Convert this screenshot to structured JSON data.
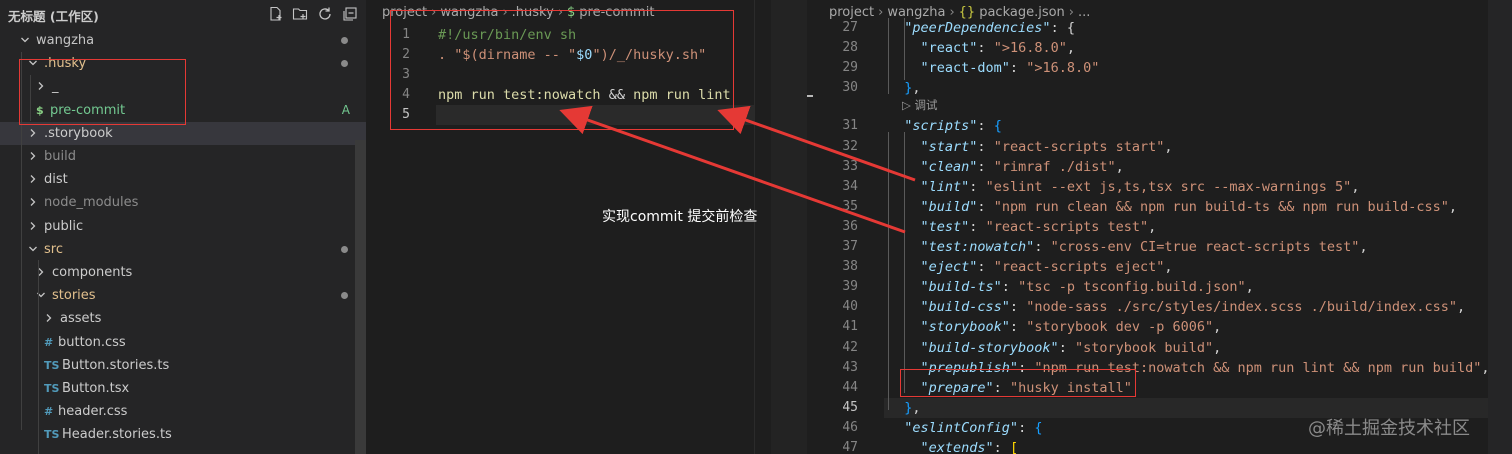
{
  "explorer": {
    "title": "无标题 (工作区)",
    "actions": [
      "new-file-icon",
      "new-folder-icon",
      "refresh-icon",
      "collapse-all-icon"
    ],
    "rows": [
      {
        "label": "wangzha",
        "type": "folder",
        "open": true,
        "depth": 1,
        "color": "#c5c5c5",
        "dot": true
      },
      {
        "label": ".husky",
        "type": "folder",
        "open": true,
        "depth": 2,
        "color": "#e2c08d",
        "dot": true
      },
      {
        "label": "_",
        "type": "folder",
        "open": false,
        "depth": 3,
        "color": "#cccccc"
      },
      {
        "label": "pre-commit",
        "type": "file",
        "icon": "$",
        "iconColor": "#89d185",
        "depth": 3,
        "color": "#73c991",
        "badge": "A"
      },
      {
        "label": ".storybook",
        "type": "folder",
        "open": false,
        "depth": 2,
        "color": "#cccccc",
        "selected": true
      },
      {
        "label": "build",
        "type": "folder",
        "open": false,
        "depth": 2,
        "color": "#8c8c8c"
      },
      {
        "label": "dist",
        "type": "folder",
        "open": false,
        "depth": 2,
        "color": "#cccccc"
      },
      {
        "label": "node_modules",
        "type": "folder",
        "open": false,
        "depth": 2,
        "color": "#8c8c8c"
      },
      {
        "label": "public",
        "type": "folder",
        "open": false,
        "depth": 2,
        "color": "#cccccc"
      },
      {
        "label": "src",
        "type": "folder",
        "open": true,
        "depth": 2,
        "color": "#e2c08d",
        "dot": true
      },
      {
        "label": "components",
        "type": "folder",
        "open": false,
        "depth": 3,
        "color": "#cccccc"
      },
      {
        "label": "stories",
        "type": "folder",
        "open": true,
        "depth": 3,
        "color": "#e2c08d",
        "dot": true
      },
      {
        "label": "assets",
        "type": "folder",
        "open": false,
        "depth": 4,
        "color": "#cccccc"
      },
      {
        "label": "button.css",
        "type": "file",
        "icon": "#",
        "iconColor": "#519aba",
        "depth": 4,
        "color": "#cccccc"
      },
      {
        "label": "Button.stories.ts",
        "type": "file",
        "icon": "TS",
        "iconColor": "#519aba",
        "depth": 4,
        "color": "#cccccc"
      },
      {
        "label": "Button.tsx",
        "type": "file",
        "icon": "TS",
        "iconColor": "#519aba",
        "depth": 4,
        "color": "#cccccc"
      },
      {
        "label": "header.css",
        "type": "file",
        "icon": "#",
        "iconColor": "#519aba",
        "depth": 4,
        "color": "#cccccc"
      },
      {
        "label": "Header.stories.ts",
        "type": "file",
        "icon": "TS",
        "iconColor": "#519aba",
        "depth": 4,
        "color": "#cccccc"
      }
    ]
  },
  "editor1": {
    "breadcrumb": [
      "project",
      "wangzha",
      ".husky",
      "$",
      "pre-commit"
    ],
    "lines": [
      {
        "n": "1",
        "tokens": [
          {
            "t": "#!/usr/bin/env sh",
            "c": "c-comment"
          }
        ]
      },
      {
        "n": "2",
        "tokens": [
          {
            "t": ". \"$(dirname -- \"",
            "c": "c-str"
          },
          {
            "t": "$0",
            "c": "c-var"
          },
          {
            "t": "\")/_/husky.sh\"",
            "c": "c-str"
          }
        ]
      },
      {
        "n": "3",
        "tokens": []
      },
      {
        "n": "4",
        "tokens": [
          {
            "t": "npm run test:nowatch",
            "c": "c-yellow"
          },
          {
            "t": " && ",
            "c": "c-plain"
          },
          {
            "t": "npm run lint",
            "c": "c-yellow"
          }
        ]
      },
      {
        "n": "5",
        "tokens": [],
        "active": true
      }
    ]
  },
  "editor2": {
    "breadcrumb": [
      "project",
      "wangzha",
      "{}",
      "package.json",
      "..."
    ],
    "codelens": "调试",
    "lines": [
      {
        "n": "27",
        "tokens": [
          {
            "t": "  ",
            "c": "c-plain"
          },
          {
            "t": "\"peerDependencies\"",
            "c": "c-key"
          },
          {
            "t": ": {",
            "c": "c-plain"
          }
        ]
      },
      {
        "n": "28",
        "tokens": [
          {
            "t": "    ",
            "c": "c-plain"
          },
          {
            "t": "\"react\"",
            "c": "c-var"
          },
          {
            "t": ": ",
            "c": "c-plain"
          },
          {
            "t": "\">16.8.0\"",
            "c": "c-str"
          },
          {
            "t": ",",
            "c": "c-plain"
          }
        ]
      },
      {
        "n": "29",
        "tokens": [
          {
            "t": "    ",
            "c": "c-plain"
          },
          {
            "t": "\"react-dom\"",
            "c": "c-var"
          },
          {
            "t": ": ",
            "c": "c-plain"
          },
          {
            "t": "\">16.8.0\"",
            "c": "c-str"
          }
        ]
      },
      {
        "n": "30",
        "tokens": [
          {
            "t": "  ",
            "c": "c-plain"
          },
          {
            "t": "}",
            "c": "c-brace2"
          },
          {
            "t": ",",
            "c": "c-plain"
          }
        ]
      },
      {
        "n": "31",
        "tokens": [
          {
            "t": "  ",
            "c": "c-plain"
          },
          {
            "t": "\"scripts\"",
            "c": "c-key"
          },
          {
            "t": ": ",
            "c": "c-plain"
          },
          {
            "t": "{",
            "c": "c-brace2"
          }
        ]
      },
      {
        "n": "32",
        "tokens": [
          {
            "t": "    ",
            "c": "c-plain"
          },
          {
            "t": "\"start\"",
            "c": "c-key"
          },
          {
            "t": ": ",
            "c": "c-plain"
          },
          {
            "t": "\"react-scripts start\"",
            "c": "c-str"
          },
          {
            "t": ",",
            "c": "c-plain"
          }
        ]
      },
      {
        "n": "33",
        "tokens": [
          {
            "t": "    ",
            "c": "c-plain"
          },
          {
            "t": "\"clean\"",
            "c": "c-key"
          },
          {
            "t": ": ",
            "c": "c-plain"
          },
          {
            "t": "\"rimraf ./dist\"",
            "c": "c-str"
          },
          {
            "t": ",",
            "c": "c-plain"
          }
        ]
      },
      {
        "n": "34",
        "tokens": [
          {
            "t": "    ",
            "c": "c-plain"
          },
          {
            "t": "\"lint\"",
            "c": "c-key"
          },
          {
            "t": ": ",
            "c": "c-plain"
          },
          {
            "t": "\"eslint --ext js,ts,tsx src --max-warnings 5\"",
            "c": "c-str"
          },
          {
            "t": ",",
            "c": "c-plain"
          }
        ]
      },
      {
        "n": "35",
        "tokens": [
          {
            "t": "    ",
            "c": "c-plain"
          },
          {
            "t": "\"build\"",
            "c": "c-key"
          },
          {
            "t": ": ",
            "c": "c-plain"
          },
          {
            "t": "\"npm run clean && npm run build-ts && npm run build-css\"",
            "c": "c-str"
          },
          {
            "t": ",",
            "c": "c-plain"
          }
        ]
      },
      {
        "n": "36",
        "tokens": [
          {
            "t": "    ",
            "c": "c-plain"
          },
          {
            "t": "\"test\"",
            "c": "c-key"
          },
          {
            "t": ": ",
            "c": "c-plain"
          },
          {
            "t": "\"react-scripts test\"",
            "c": "c-str"
          },
          {
            "t": ",",
            "c": "c-plain"
          }
        ]
      },
      {
        "n": "37",
        "tokens": [
          {
            "t": "    ",
            "c": "c-plain"
          },
          {
            "t": "\"test:nowatch\"",
            "c": "c-key"
          },
          {
            "t": ": ",
            "c": "c-plain"
          },
          {
            "t": "\"cross-env CI=true react-scripts test\"",
            "c": "c-str"
          },
          {
            "t": ",",
            "c": "c-plain"
          }
        ]
      },
      {
        "n": "38",
        "tokens": [
          {
            "t": "    ",
            "c": "c-plain"
          },
          {
            "t": "\"eject\"",
            "c": "c-key"
          },
          {
            "t": ": ",
            "c": "c-plain"
          },
          {
            "t": "\"react-scripts eject\"",
            "c": "c-str"
          },
          {
            "t": ",",
            "c": "c-plain"
          }
        ]
      },
      {
        "n": "39",
        "tokens": [
          {
            "t": "    ",
            "c": "c-plain"
          },
          {
            "t": "\"build-ts\"",
            "c": "c-key"
          },
          {
            "t": ": ",
            "c": "c-plain"
          },
          {
            "t": "\"tsc -p tsconfig.build.json\"",
            "c": "c-str"
          },
          {
            "t": ",",
            "c": "c-plain"
          }
        ]
      },
      {
        "n": "40",
        "tokens": [
          {
            "t": "    ",
            "c": "c-plain"
          },
          {
            "t": "\"build-css\"",
            "c": "c-key"
          },
          {
            "t": ": ",
            "c": "c-plain"
          },
          {
            "t": "\"node-sass ./src/styles/index.scss ./build/index.css\"",
            "c": "c-str"
          },
          {
            "t": ",",
            "c": "c-plain"
          }
        ]
      },
      {
        "n": "41",
        "tokens": [
          {
            "t": "    ",
            "c": "c-plain"
          },
          {
            "t": "\"storybook\"",
            "c": "c-key"
          },
          {
            "t": ": ",
            "c": "c-plain"
          },
          {
            "t": "\"storybook dev -p 6006\"",
            "c": "c-str"
          },
          {
            "t": ",",
            "c": "c-plain"
          }
        ]
      },
      {
        "n": "42",
        "tokens": [
          {
            "t": "    ",
            "c": "c-plain"
          },
          {
            "t": "\"build-storybook\"",
            "c": "c-key"
          },
          {
            "t": ": ",
            "c": "c-plain"
          },
          {
            "t": "\"storybook build\"",
            "c": "c-str"
          },
          {
            "t": ",",
            "c": "c-plain"
          }
        ]
      },
      {
        "n": "43",
        "tokens": [
          {
            "t": "    ",
            "c": "c-plain"
          },
          {
            "t": "\"prepublish\"",
            "c": "c-key"
          },
          {
            "t": ": ",
            "c": "c-plain"
          },
          {
            "t": "\"npm run test:nowatch && npm run lint && npm run build\"",
            "c": "c-str"
          },
          {
            "t": ",",
            "c": "c-plain"
          }
        ]
      },
      {
        "n": "44",
        "tokens": [
          {
            "t": "    ",
            "c": "c-plain"
          },
          {
            "t": "\"prepare\"",
            "c": "c-key"
          },
          {
            "t": ": ",
            "c": "c-plain"
          },
          {
            "t": "\"husky install\"",
            "c": "c-str"
          }
        ]
      },
      {
        "n": "45",
        "tokens": [
          {
            "t": "  ",
            "c": "c-plain"
          },
          {
            "t": "}",
            "c": "c-brace2"
          },
          {
            "t": ",",
            "c": "c-plain"
          }
        ],
        "active": true
      },
      {
        "n": "46",
        "tokens": [
          {
            "t": "  ",
            "c": "c-plain"
          },
          {
            "t": "\"eslintConfig\"",
            "c": "c-key"
          },
          {
            "t": ": ",
            "c": "c-plain"
          },
          {
            "t": "{",
            "c": "c-brace2"
          }
        ]
      },
      {
        "n": "47",
        "tokens": [
          {
            "t": "    ",
            "c": "c-plain"
          },
          {
            "t": "\"extends\"",
            "c": "c-key"
          },
          {
            "t": ": ",
            "c": "c-plain"
          },
          {
            "t": "[",
            "c": "c-brace3"
          }
        ]
      }
    ]
  },
  "annotation": "实现commit 提交前检查",
  "watermark": "@稀土掘金技术社区",
  "colors": {
    "highlight": "#e53935",
    "selection": "#37373d",
    "activeLine": "#282828"
  }
}
